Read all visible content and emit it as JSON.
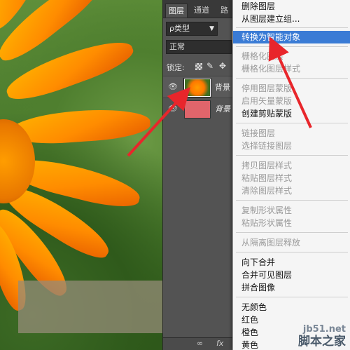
{
  "layers_panel": {
    "tabs": [
      "图层",
      "通道",
      "路"
    ],
    "filter_label": "ρ类型",
    "blend_mode": "正常",
    "lock_label": "锁定:",
    "layers": [
      {
        "name": "背景",
        "selected": true
      },
      {
        "name": "背景",
        "selected": false
      }
    ],
    "bottom_icons": [
      "∞",
      "fx"
    ]
  },
  "context_menu": {
    "items": [
      {
        "label": "删除图层",
        "disabled": false,
        "highlighted": false
      },
      {
        "label": "从图层建立组...",
        "disabled": false,
        "highlighted": false
      },
      {
        "label": "转换为智能对象",
        "disabled": false,
        "highlighted": true
      },
      {
        "label": "栅格化图层",
        "disabled": true,
        "highlighted": false
      },
      {
        "label": "栅格化图层样式",
        "disabled": true,
        "highlighted": false
      },
      {
        "label": "停用图层蒙版",
        "disabled": true,
        "highlighted": false
      },
      {
        "label": "启用矢量蒙版",
        "disabled": true,
        "highlighted": false
      },
      {
        "label": "创建剪贴蒙版",
        "disabled": false,
        "highlighted": false
      },
      {
        "label": "链接图层",
        "disabled": true,
        "highlighted": false
      },
      {
        "label": "选择链接图层",
        "disabled": true,
        "highlighted": false
      },
      {
        "label": "拷贝图层样式",
        "disabled": true,
        "highlighted": false
      },
      {
        "label": "粘贴图层样式",
        "disabled": true,
        "highlighted": false
      },
      {
        "label": "清除图层样式",
        "disabled": true,
        "highlighted": false
      },
      {
        "label": "复制形状属性",
        "disabled": true,
        "highlighted": false
      },
      {
        "label": "粘贴形状属性",
        "disabled": true,
        "highlighted": false
      },
      {
        "label": "从隔离图层释放",
        "disabled": true,
        "highlighted": false
      },
      {
        "label": "向下合并",
        "disabled": false,
        "highlighted": false
      },
      {
        "label": "合并可见图层",
        "disabled": false,
        "highlighted": false
      },
      {
        "label": "拼合图像",
        "disabled": false,
        "highlighted": false
      },
      {
        "label": "无颜色",
        "disabled": false,
        "highlighted": false
      },
      {
        "label": "红色",
        "disabled": false,
        "highlighted": false
      },
      {
        "label": "橙色",
        "disabled": false,
        "highlighted": false
      },
      {
        "label": "黄色",
        "disabled": false,
        "highlighted": false
      }
    ]
  },
  "watermark": {
    "site": "jb51.net",
    "name": "脚本之家"
  },
  "colors": {
    "highlight": "#3a7bd5",
    "arrow": "#e8262b",
    "layer2_thumb": "#e0656b"
  }
}
